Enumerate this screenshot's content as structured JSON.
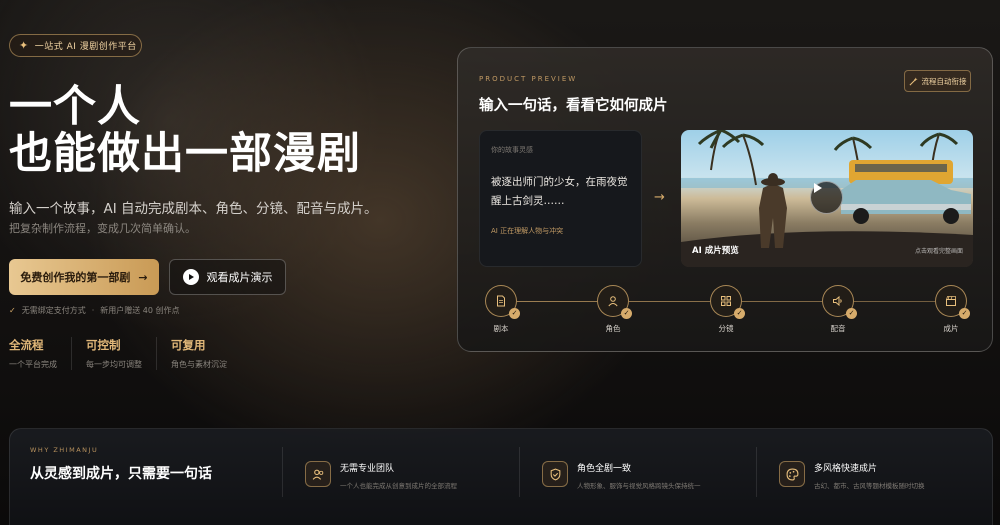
{
  "hero": {
    "badge": "一站式 AI 漫剧创作平台",
    "title_line1": "一个人",
    "title_line2": "也能做出一部漫剧",
    "subtitle": "输入一个故事，AI 自动完成剧本、角色、分镜、配音与成片。",
    "subtitle2": "把复杂制作流程，变成几次简单确认。",
    "cta_primary": "免费创作我的第一部剧",
    "cta_secondary": "观看成片演示",
    "note_item1": "无需绑定支付方式",
    "note_item2": "新用户赠送 40 创作点",
    "stats": [
      {
        "label": "全流程",
        "desc": "一个平台完成"
      },
      {
        "label": "可控制",
        "desc": "每一步均可调整"
      },
      {
        "label": "可复用",
        "desc": "角色与素材沉淀"
      }
    ]
  },
  "preview": {
    "eyebrow": "PRODUCT PREVIEW",
    "title": "输入一句话，看看它如何成片",
    "tag": "流程自动衔接",
    "story_label": "你的故事灵感",
    "story_text": "被逐出师门的少女，在雨夜觉醒上古剑灵……",
    "story_status": "AI 正在理解人物与冲突",
    "scene_label": "AI 成片预览",
    "scene_hint": "点击观看完整画面",
    "steps": [
      {
        "name": "剧本",
        "icon": "document-icon"
      },
      {
        "name": "角色",
        "icon": "user-icon"
      },
      {
        "name": "分镜",
        "icon": "grid-icon"
      },
      {
        "name": "配音",
        "icon": "speaker-icon"
      },
      {
        "name": "成片",
        "icon": "clapperboard-icon"
      }
    ]
  },
  "why": {
    "eyebrow": "WHY ZHIMANJU",
    "title": "从灵感到成片，只需要一句话",
    "features": [
      {
        "title": "无需专业团队",
        "desc": "一个人也能完成从创意到成片的全部流程",
        "icon": "team-icon"
      },
      {
        "title": "角色全剧一致",
        "desc": "人物形象、服饰与视觉风格跨镜头保持统一",
        "icon": "shield-check-icon"
      },
      {
        "title": "多风格快速成片",
        "desc": "古幻、都市、古风等题材模板随时切换",
        "icon": "palette-icon"
      }
    ]
  },
  "colors": {
    "accent": "#d6ab6b",
    "background": "#131110"
  }
}
